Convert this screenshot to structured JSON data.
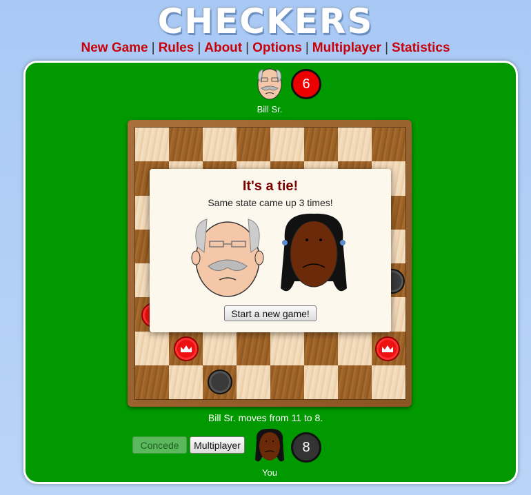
{
  "header": {
    "title": "CHECKERS"
  },
  "nav": {
    "items": [
      {
        "label": "New Game"
      },
      {
        "label": "Rules"
      },
      {
        "label": "About"
      },
      {
        "label": "Options"
      },
      {
        "label": "Multiplayer"
      },
      {
        "label": "Statistics"
      }
    ]
  },
  "opponent": {
    "name": "Bill Sr.",
    "count": "6",
    "color": "#e00000"
  },
  "player": {
    "name": "You",
    "count": "8",
    "color": "#333333"
  },
  "status": "Bill Sr. moves from 11 to 8.",
  "buttons": {
    "concede": "Concede",
    "multiplayer": "Multiplayer",
    "new_game": "Start a new game!"
  },
  "modal": {
    "title": "It's a tie!",
    "message": "Same state came up 3 times!"
  },
  "colors": {
    "panel": "#009900",
    "accent": "#c8000a"
  }
}
